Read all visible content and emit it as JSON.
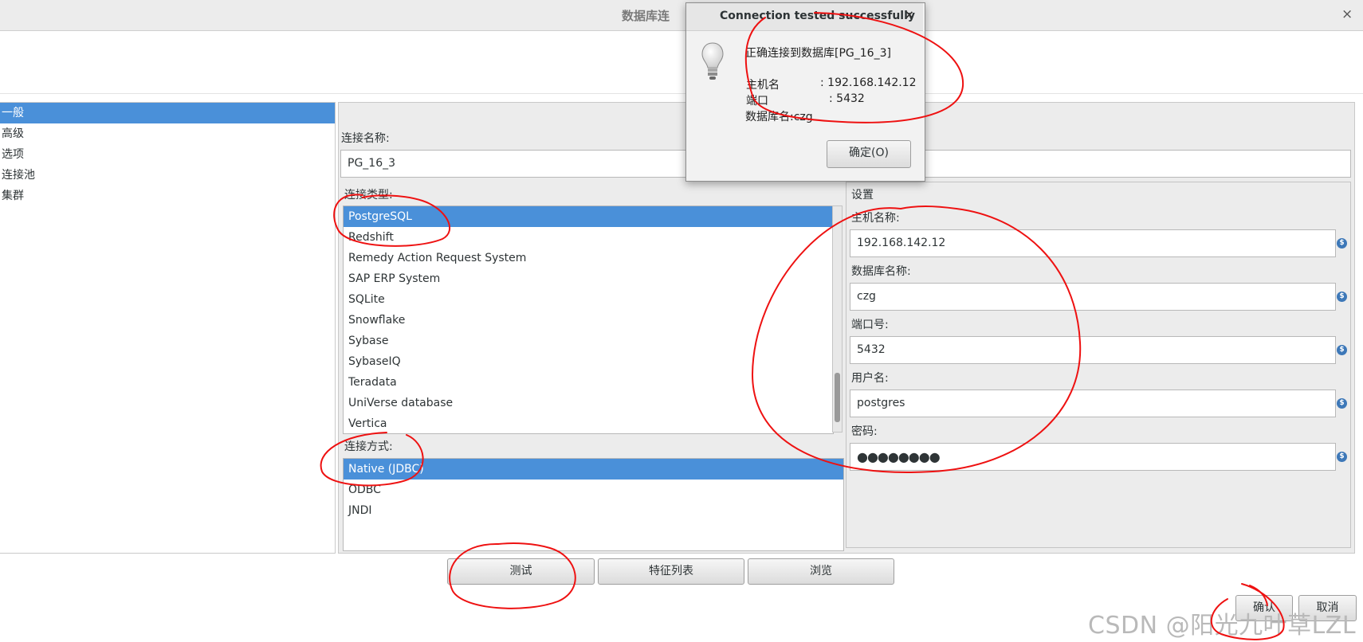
{
  "window": {
    "title": "数据库连",
    "close_glyph": "×"
  },
  "nav": {
    "items": [
      {
        "label": "一般",
        "selected": true
      },
      {
        "label": "高级",
        "selected": false
      },
      {
        "label": "选项",
        "selected": false
      },
      {
        "label": "连接池",
        "selected": false
      },
      {
        "label": "集群",
        "selected": false
      }
    ]
  },
  "general": {
    "conn_name_label": "连接名称:",
    "conn_name_value": "PG_16_3",
    "conn_type_label": "连接类型:",
    "conn_types": [
      {
        "label": "PostgreSQL",
        "selected": true
      },
      {
        "label": "Redshift",
        "selected": false
      },
      {
        "label": "Remedy Action Request System",
        "selected": false
      },
      {
        "label": "SAP ERP System",
        "selected": false
      },
      {
        "label": "SQLite",
        "selected": false
      },
      {
        "label": "Snowflake",
        "selected": false
      },
      {
        "label": "Sybase",
        "selected": false
      },
      {
        "label": "SybaseIQ",
        "selected": false
      },
      {
        "label": "Teradata",
        "selected": false
      },
      {
        "label": "UniVerse database",
        "selected": false
      },
      {
        "label": "Vertica",
        "selected": false
      }
    ],
    "conn_method_label": "连接方式:",
    "conn_methods": [
      {
        "label": "Native (JDBC)",
        "selected": true
      },
      {
        "label": "ODBC",
        "selected": false
      },
      {
        "label": "JNDI",
        "selected": false
      }
    ]
  },
  "settings": {
    "title": "设置",
    "fields": [
      {
        "label": "主机名称:",
        "value": "192.168.142.12"
      },
      {
        "label": "数据库名称:",
        "value": "czg"
      },
      {
        "label": "端口号:",
        "value": "5432"
      },
      {
        "label": "用户名:",
        "value": "postgres"
      },
      {
        "label": "密码:",
        "value": "●●●●●●●●"
      }
    ],
    "var_icon_glyph": "$"
  },
  "buttons": {
    "test": "测试",
    "feature_list": "特征列表",
    "explore": "浏览",
    "ok": "确认",
    "cancel": "取消"
  },
  "dialog": {
    "title": "Connection tested successfully",
    "close_glyph": "×",
    "message": "正确连接到数据库[PG_16_3]",
    "host_label": "主机名",
    "host_value": ": 192.168.142.12",
    "port_label": "端口",
    "port_value": ": 5432",
    "db_line": "数据库名:czg",
    "ok_button": "确定(O)"
  },
  "watermark": "CSDN @阳光九叶草LZL",
  "colors": {
    "selection": "#4a90d9",
    "annotation": "#ee1111"
  }
}
